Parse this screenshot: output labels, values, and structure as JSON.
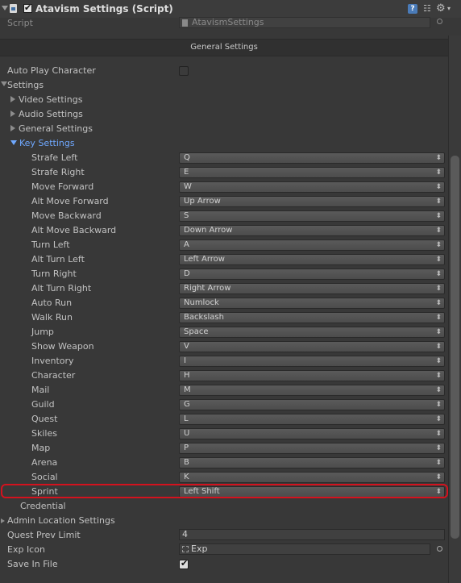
{
  "header": {
    "title": "Atavism Settings (Script)",
    "enabled": true,
    "help_glyph": "?"
  },
  "script_row": {
    "label": "Script",
    "value": "AtavismSettings"
  },
  "section_title": "General Settings",
  "auto_play": {
    "label": "Auto Play Character",
    "checked": false
  },
  "settings": {
    "label": "Settings",
    "subsections": [
      "Video Settings",
      "Audio Settings",
      "General Settings"
    ],
    "key_settings_label": "Key Settings",
    "keys": [
      {
        "label": "Strafe Left",
        "value": "Q"
      },
      {
        "label": "Strafe Right",
        "value": "E"
      },
      {
        "label": "Move Forward",
        "value": "W"
      },
      {
        "label": "Alt Move Forward",
        "value": "Up Arrow"
      },
      {
        "label": "Move Backward",
        "value": "S"
      },
      {
        "label": "Alt Move Backward",
        "value": "Down Arrow"
      },
      {
        "label": "Turn Left",
        "value": "A"
      },
      {
        "label": "Alt Turn Left",
        "value": "Left Arrow"
      },
      {
        "label": "Turn Right",
        "value": "D"
      },
      {
        "label": "Alt Turn Right",
        "value": "Right Arrow"
      },
      {
        "label": "Auto Run",
        "value": "Numlock"
      },
      {
        "label": "Walk Run",
        "value": "Backslash"
      },
      {
        "label": "Jump",
        "value": "Space"
      },
      {
        "label": "Show Weapon",
        "value": "V"
      },
      {
        "label": "Inventory",
        "value": "I"
      },
      {
        "label": "Character",
        "value": "H"
      },
      {
        "label": "Mail",
        "value": "M"
      },
      {
        "label": "Guild",
        "value": "G"
      },
      {
        "label": "Quest",
        "value": "L"
      },
      {
        "label": "Skiles",
        "value": "U"
      },
      {
        "label": "Map",
        "value": "P"
      },
      {
        "label": "Arena",
        "value": "B"
      },
      {
        "label": "Social",
        "value": "K"
      },
      {
        "label": "Sprint",
        "value": "Left Shift"
      }
    ],
    "credential_label": "Credential"
  },
  "admin_location_label": "Admin Location Settings",
  "quest_prev_limit": {
    "label": "Quest Prev Limit",
    "value": "4"
  },
  "exp_icon": {
    "label": "Exp Icon",
    "value": "Exp"
  },
  "save_in_file": {
    "label": "Save In File",
    "checked": true
  }
}
